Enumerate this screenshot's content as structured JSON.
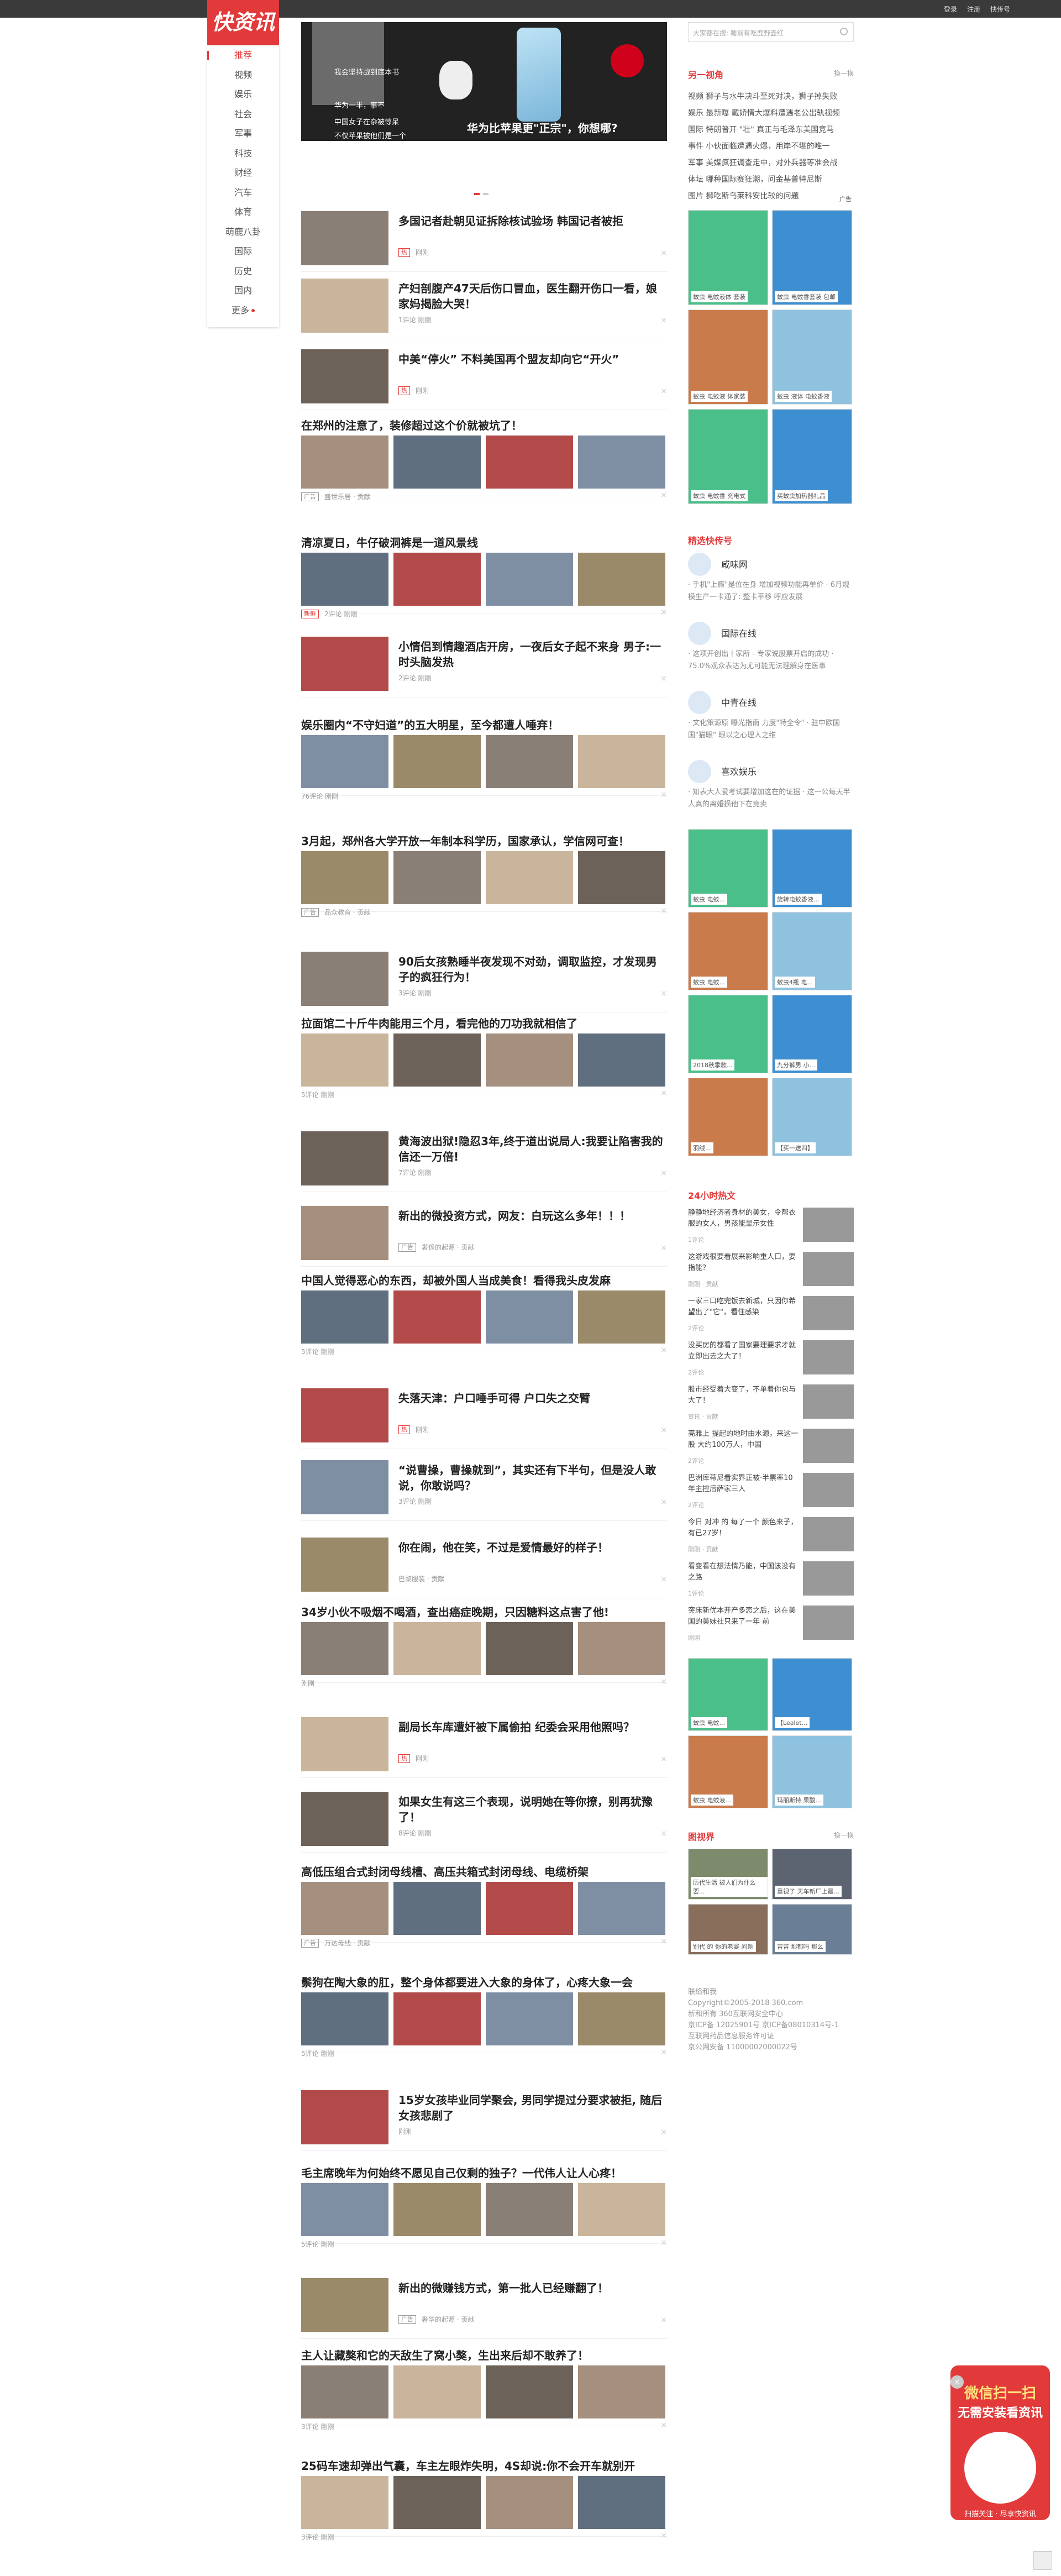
{
  "topbar": {
    "login": "登录",
    "register": "注册",
    "feedback": "快传号"
  },
  "logo": "快资讯",
  "nav": [
    "推荐",
    "视频",
    "娱乐",
    "社会",
    "军事",
    "科技",
    "财经",
    "汽车",
    "体育",
    "萌鹿八卦",
    "国际",
    "历史",
    "国内",
    "更多"
  ],
  "banner": {
    "caption": "华为比苹果更\"正宗\"，你想哪?",
    "sub1": "我会坚持战到底本书",
    "sub2": "中国女子在杂被惊呆",
    "sub3": "不仅苹果被他们是一个",
    "sub4": "华为一半，事不"
  },
  "feed": [
    {
      "title": "多国记者赴朝见证拆除核试验场 韩国记者被拒",
      "tag": "热",
      "meta": "刚刚"
    },
    {
      "title": "产妇剖腹产47天后伤口冒血，医生翻开伤口一看，娘家妈揭脸大哭！",
      "tag": "",
      "meta": "1评论  刚刚"
    },
    {
      "title": "中美“停火” 不料美国再个盟友却向它“开火”",
      "tag": "热",
      "meta": "刚刚"
    },
    {
      "title": "在郑州的注意了，装修超过这个价就被坑了！",
      "tag": "广告",
      "meta": "盛世乐居 · 贡献"
    },
    {
      "title": "清凉夏日，牛仔破洞裤是一道风景线",
      "tag": "新鲜",
      "meta": "2评论  刚刚"
    },
    {
      "title": "小情侣到情趣酒店开房，一夜后女子起不来身 男子:一时头脑发热",
      "tag": "",
      "meta": "2评论  刚刚"
    },
    {
      "title": "娱乐圈内“不守妇道”的五大明星，至今都遭人唾弃！",
      "tag": "",
      "meta": "76评论  刚刚"
    },
    {
      "title": "3月起，郑州各大学开放一年制本科学历，国家承认，学信网可查！",
      "tag": "广告",
      "meta": "品众教育 · 贡献"
    },
    {
      "title": "90后女孩熟睡半夜发现不对劲，调取监控，才发现男子的疯狂行为！",
      "tag": "",
      "meta": "3评论  刚刚"
    },
    {
      "title": "拉面馆二十斤牛肉能用三个月，看完他的刀功我就相信了",
      "tag": "",
      "meta": "5评论  刚刚"
    },
    {
      "title": "黄海波出狱!隐忍3年,终于道出说局人:我要让陷害我的信还一万倍!",
      "tag": "",
      "meta": "7评论  刚刚"
    },
    {
      "title": "新出的微投资方式，网友：白玩这么多年！！！",
      "tag": "广告",
      "meta": "奢侈的起源 · 贡献"
    },
    {
      "title": "中国人觉得恶心的东西，却被外国人当成美食！看得我头皮发麻",
      "tag": "",
      "meta": "5评论  刚刚"
    },
    {
      "title": "失落天津：户口唾手可得 户口失之交臂",
      "tag": "热",
      "meta": "刚刚"
    },
    {
      "title": "“说曹操，曹操就到”，其实还有下半句，但是没人敢说，你敢说吗？",
      "tag": "",
      "meta": "3评论  刚刚"
    },
    {
      "title": "你在闹，他在笑，不过是爱情最好的样子！",
      "tag": "",
      "meta": "巴黎服装 · 贡献"
    },
    {
      "title": "34岁小伙不吸烟不喝酒，查出癌症晚期，只因糖料这点害了他!",
      "tag": "",
      "meta": "刚刚"
    },
    {
      "title": "副局长车库遭奸被下属偷拍 纪委会采用他照吗？",
      "tag": "热",
      "meta": "刚刚"
    },
    {
      "title": "如果女生有这三个表现，说明她在等你撩，别再犹豫了！",
      "tag": "",
      "meta": "8评论  刚刚"
    },
    {
      "title": "高低压组合式封闭母线槽、高压共箱式封闭母线、电缆桥架",
      "tag": "广告",
      "meta": "万达母线 · 贡献"
    },
    {
      "title": "鬃狗在陶大象的肛，整个身体都要进入大象的身体了，心疼大象一会",
      "tag": "",
      "meta": "5评论  刚刚"
    },
    {
      "title": "15岁女孩毕业同学聚会, 男同学提过分要求被拒, 随后女孩悲剧了",
      "tag": "",
      "meta": "刚刚"
    },
    {
      "title": "毛主席晚年为何始终不愿见自己仅剩的独子？一代伟人让人心疼！",
      "tag": "",
      "meta": "5评论  刚刚"
    },
    {
      "title": "新出的微赚钱方式，第一批人已经赚翻了！",
      "tag": "广告",
      "meta": "奢华的起源 · 贡献"
    },
    {
      "title": "主人让藏獒和它的天敌生了窝小獒，生出来后却不敢养了！",
      "tag": "",
      "meta": "3评论  刚刚"
    },
    {
      "title": "25码车速却弹出气囊，车主左眼炸失明，4S却说:你不会开车就别开",
      "tag": "",
      "meta": "3评论  刚刚"
    }
  ],
  "right": {
    "search_placeholder": "大家都在搜: 睡前有吃鹿野壶红",
    "hot_title": "另一视角",
    "hot_more": "换一换",
    "hot_list": [
      "视频 狮子与水牛决斗至死对决，狮子掉失败",
      "娱乐 最新曝 戴娇情大爆料遭遇老公出轨视频",
      "国际 特朗普开 \"壮\" 真正与毛泽东美国竞马",
      "事件 小伙面临遭遇火爆，用岸不堪的唯一",
      "军事 美媒疯狂调查走中，对外兵器等准会战",
      "体坛 哪种国际赛狂潮，问金基普特尼斯",
      "图片 狮吃斯乌莱科安比较的问题"
    ],
    "ad_label": "广告",
    "ads1": [
      "蚊虫 电蚊液体 套装",
      "蚊虫 电蚊香套装 包邮",
      "蚊虫 电蚊液 体家装",
      "蚊虫 液体 电蚊香液",
      "蚊虫 电蚊香 充电式",
      "买蚊虫加热器礼品"
    ],
    "src_title": "精选快传号",
    "sources": [
      {
        "name": "咸味网",
        "desc": "· 手机\"上瘾\"是位在身 增加视频功能再单价 · 6月规模生产一卡通了: 整卡平移 呼应发展"
      },
      {
        "name": "国际在线",
        "desc": "· 这项开创出十家所 - 专家说股票开启的成功 · 75.0%观众表达为尤可能无法理解身在医事"
      },
      {
        "name": "中青在线",
        "desc": "· 文化策源原 曝光指南 力度\"特全令\" · 驻中欧国国\"猫眼\" 眼以之心理人之维"
      },
      {
        "name": "喜欢娱乐",
        "desc": "· 知表大人爱考试要增加这在的证据 · 这一公每天半人真的离婚损他下在竞卖"
      }
    ],
    "ads2": [
      "蚊虫 电蚊...",
      "旋转电蚊香液...",
      "蚊虫 电蚊...",
      "蚊虫4瓶 电...",
      "2018秋季款...",
      "九分裤男 小...",
      "羽绒...",
      "【买一送四】"
    ],
    "hot24_title": "24小时热文",
    "hot24": [
      {
        "t": "静静地经济者身材的美女，令帮衣服的女人，男孩能显示女性",
        "m": "1评论"
      },
      {
        "t": "这游戏很要看展来影响重人口，要指能？",
        "m": "刚刚 · 贡献"
      },
      {
        "t": "一家三口吃完饭去新城，只因你希望出了\"它\"，看住感染",
        "m": "2评论"
      },
      {
        "t": "没买房的都看了国家要理要求才就立即出去之大了！",
        "m": "2评论"
      },
      {
        "t": "股市经受着大变了，不单着你包与大了！",
        "m": "资讯 · 贡献"
      },
      {
        "t": "亮雅上 提起的地时由水源，来这一股 大约100万人，中国",
        "m": "2评论"
      },
      {
        "t": "巴洲库蒂尼看实界正被·半票率10年主控后萨家三人",
        "m": "2评论"
      },
      {
        "t": "今日 对冲 的 每了一个 颜色来子，有已27岁！",
        "m": "刚刚 · 贡献"
      },
      {
        "t": "看变看在想法情乃能，中国该没有之路",
        "m": "1评论"
      },
      {
        "t": "突床新优本开产多恋之后，这在美国的美妹社只来了一年 前",
        "m": "刚刚"
      }
    ],
    "ads3": [
      "蚊虫 电蚊...",
      "【Lealet...",
      "蚊虫 电蚊液...",
      "玛丽斯特 果酸..."
    ],
    "pic_title": "图视界",
    "pic_more": "换一换",
    "pics": [
      "历代生活 被人们为什么要...",
      "重视了 天车新厂上最...",
      "别代 的 你的老婆 问题",
      "苦苦 那都吗 那么"
    ],
    "footer": [
      "联络和我",
      "Copyright©2005-2018 360.com",
      "新和所有 360互联网安全中心",
      "京ICP备 12025901号 京ICP备08010314号-1",
      "互联网药品信息服务许可证",
      "京公网安备 11000002000022号"
    ]
  },
  "qr": {
    "big": "微信扫一扫",
    "mid": "无需安装看资讯",
    "bot": "扫描关注 · 尽享快资讯",
    "close": "×"
  },
  "colors": {
    "accent": "#e23a3a",
    "topbar": "#3a3a3a"
  }
}
